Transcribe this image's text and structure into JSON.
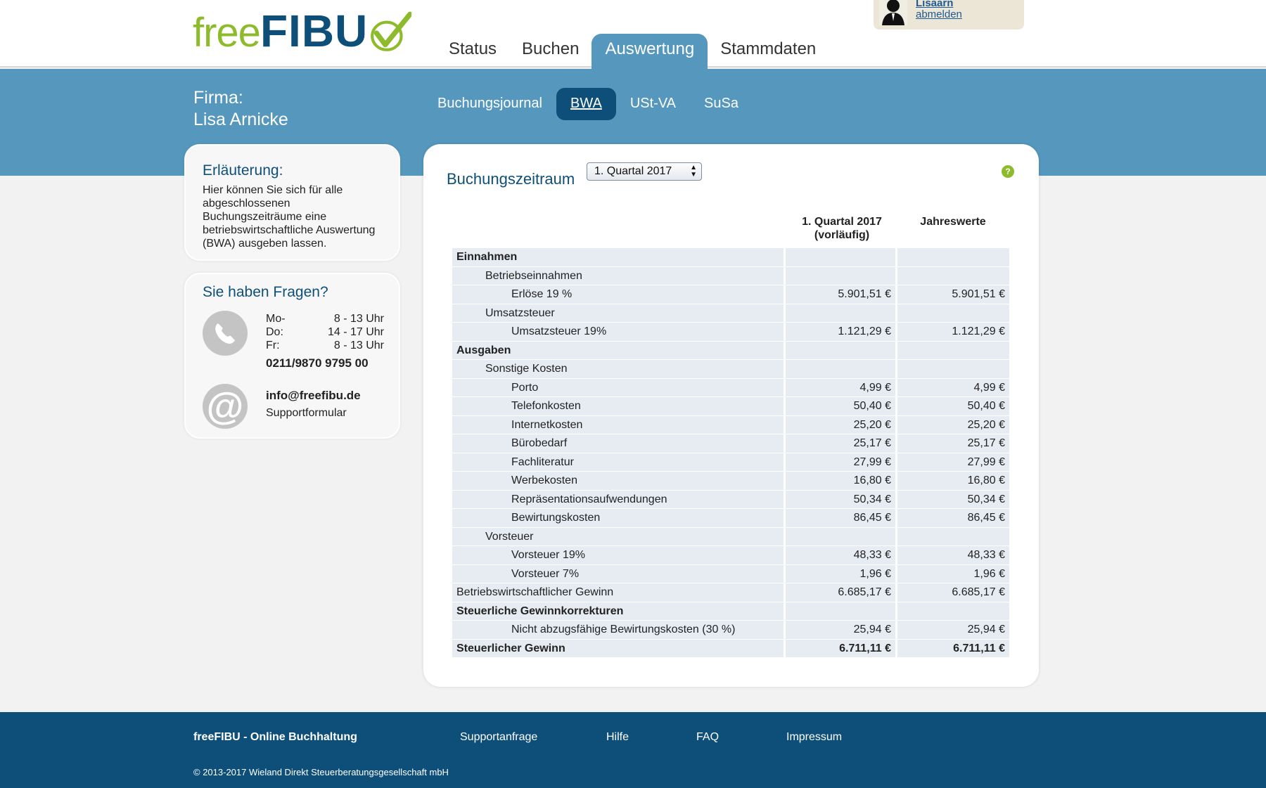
{
  "brand": {
    "logo_part1": "free",
    "logo_part2": "FIBU"
  },
  "main_nav": [
    "Status",
    "Buchen",
    "Auswertung",
    "Stammdaten"
  ],
  "user": {
    "name": "Lisaarn",
    "logout": "abmelden"
  },
  "firma": {
    "label": "Firma:",
    "name": "Lisa Arnicke"
  },
  "sub_nav": [
    "Buchungsjournal",
    "BWA",
    "USt-VA",
    "SuSa"
  ],
  "explanation": {
    "title": "Erläuterung:",
    "text": "Hier können Sie sich für alle abgeschlossenen Buchungszeiträume eine betriebswirtschaftliche Auswertung (BWA) ausgeben lassen."
  },
  "contact": {
    "title": "Sie haben Fragen?",
    "hours": [
      {
        "day": "Mo-",
        "time": "8 - 13 Uhr"
      },
      {
        "day": "Do:",
        "time": "14 - 17 Uhr"
      },
      {
        "day": "Fr:",
        "time": "8 - 13 Uhr"
      }
    ],
    "phone": "0211/9870 9795 00",
    "email": "info@freefibu.de",
    "form": "Supportformular"
  },
  "report": {
    "period_label": "Buchungszeitraum",
    "period_value": "1. Quartal 2017",
    "col1": "1. Quartal 2017 (vorläufig)",
    "col2": "Jahreswerte",
    "rows": [
      {
        "label": "Einnahmen",
        "v1": "",
        "v2": ""
      },
      {
        "label": "Betriebseinnahmen",
        "v1": "",
        "v2": ""
      },
      {
        "label": "Erlöse 19 %",
        "v1": "5.901,51 €",
        "v2": "5.901,51 €"
      },
      {
        "label": "Umsatzsteuer",
        "v1": "",
        "v2": ""
      },
      {
        "label": "Umsatzsteuer 19%",
        "v1": "1.121,29 €",
        "v2": "1.121,29 €"
      },
      {
        "label": "Ausgaben",
        "v1": "",
        "v2": ""
      },
      {
        "label": "Sonstige Kosten",
        "v1": "",
        "v2": ""
      },
      {
        "label": "Porto",
        "v1": "4,99 €",
        "v2": "4,99 €"
      },
      {
        "label": "Telefonkosten",
        "v1": "50,40 €",
        "v2": "50,40 €"
      },
      {
        "label": "Internetkosten",
        "v1": "25,20 €",
        "v2": "25,20 €"
      },
      {
        "label": "Bürobedarf",
        "v1": "25,17 €",
        "v2": "25,17 €"
      },
      {
        "label": "Fachliteratur",
        "v1": "27,99 €",
        "v2": "27,99 €"
      },
      {
        "label": "Werbekosten",
        "v1": "16,80 €",
        "v2": "16,80 €"
      },
      {
        "label": "Repräsentationsaufwendungen",
        "v1": "50,34 €",
        "v2": "50,34 €"
      },
      {
        "label": "Bewirtungskosten",
        "v1": "86,45 €",
        "v2": "86,45 €"
      },
      {
        "label": "Vorsteuer",
        "v1": "",
        "v2": ""
      },
      {
        "label": "Vorsteuer 19%",
        "v1": "48,33 €",
        "v2": "48,33 €"
      },
      {
        "label": "Vorsteuer 7%",
        "v1": "1,96 €",
        "v2": "1,96 €"
      },
      {
        "label": "Betriebswirtschaftlicher Gewinn",
        "v1": "6.685,17 €",
        "v2": "6.685,17 €"
      },
      {
        "label": "Steuerliche Gewinnkorrekturen",
        "v1": "",
        "v2": ""
      },
      {
        "label": "Nicht abzugsfähige Bewirtungskosten (30 %)",
        "v1": "25,94 €",
        "v2": "25,94 €"
      },
      {
        "label": "Steuerlicher Gewinn",
        "v1": "6.711,11 €",
        "v2": "6.711,11 €"
      }
    ]
  },
  "footer": {
    "brand": "freeFIBU - Online Buchhaltung",
    "links": [
      "Supportanfrage",
      "Hilfe",
      "FAQ",
      "Impressum"
    ],
    "copyright": "© 2013-2017 Wieland Direkt Steuerberatungsgesellschaft mbH"
  },
  "colors": {
    "primary_blue": "#5597bd",
    "dark_blue": "#0e4f7a",
    "accent_green": "#8dbb2c"
  }
}
